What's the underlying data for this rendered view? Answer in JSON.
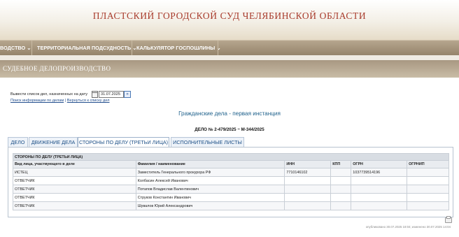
{
  "header": {
    "court_title": "ПЛАСТСКИЙ ГОРОДСКОЙ СУД ЧЕЛЯБИНСКОЙ ОБЛАСТИ"
  },
  "nav": {
    "items": [
      {
        "label": "ВОДСТВО ⌄"
      },
      {
        "label": "ТЕРРИТОРИАЛЬНАЯ ПОДСУДНОСТЬ ⌄"
      },
      {
        "label": "КАЛЬКУЛЯТОР ГОСПОШЛИНЫ ⌄"
      }
    ]
  },
  "section": {
    "title": "СУДЕБНОЕ ДЕЛОПРОИЗВОДСТВО"
  },
  "date_filter": {
    "label": "Вывести список дел, назначенных на дату",
    "value": "31.07.2025",
    "go_symbol": "»"
  },
  "links": {
    "search_info": "Поиск информации по делам",
    "separator": "|",
    "back_to_list": "Вернуться к списку дел"
  },
  "case": {
    "category": "Гражданские дела - первая инстанция",
    "number": "ДЕЛО № 2-479/2025 ~ М-344/2025"
  },
  "tabs": [
    {
      "label": "ДЕЛО"
    },
    {
      "label": "ДВИЖЕНИЕ ДЕЛА"
    },
    {
      "label": "СТОРОНЫ ПО ДЕЛУ (ТРЕТЬИ ЛИЦА)"
    },
    {
      "label": "ИСПОЛНИТЕЛЬНЫЕ ЛИСТЫ"
    }
  ],
  "parties": {
    "caption": "СТОРОНЫ ПО ДЕЛУ (ТРЕТЬИ ЛИЦА)",
    "columns": [
      "Вид лица, участвующего в деле",
      "Фамилия / наименование",
      "ИНН",
      "КПП",
      "ОГРН",
      "ОГРНИП"
    ],
    "rows": [
      [
        "ИСТЕЦ",
        "Заместитель Генерального прокурора РФ",
        "7710146102",
        "",
        "1037739514196",
        ""
      ],
      [
        "ОТВЕТЧИК",
        "Колбасин Алексей Иванович",
        "",
        "",
        "",
        ""
      ],
      [
        "ОТВЕТЧИК",
        "Потапов Владислав Валентинович",
        "",
        "",
        "",
        ""
      ],
      [
        "ОТВЕТЧИК",
        "Струков Константин Иванович",
        "",
        "",
        "",
        ""
      ],
      [
        "ОТВЕТЧИК",
        "Шувалов Юрий Александрович",
        "",
        "",
        "",
        ""
      ]
    ]
  },
  "footer": {
    "text": "опубликовано 30.07.2025 18:04; изменено 30.07.2025 14:04"
  },
  "colors": {
    "title_red": "#a83b2c",
    "nav_brown": "#95846b",
    "link_blue": "#234f8e",
    "category_blue": "#1c5f8a"
  }
}
